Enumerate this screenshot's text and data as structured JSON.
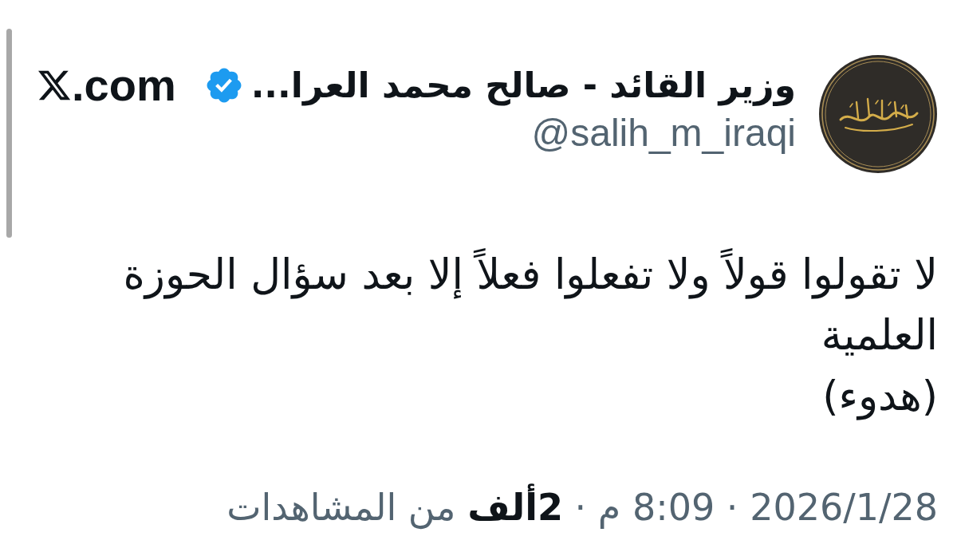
{
  "tweet": {
    "author": {
      "name": "وزير القائد - صالح محمد العرا...",
      "verified": true,
      "handle": "@salih_m_iraqi"
    },
    "site": {
      "suffix": ".com"
    },
    "body": [
      "لا تقولوا قولاً ولا تفعلوا فعلاً إلا بعد سؤال الحوزة العلمية",
      "(هدوء)"
    ],
    "meta": "2026/1/28 · 8:09 م · **2ألف** من المشاهدات"
  }
}
